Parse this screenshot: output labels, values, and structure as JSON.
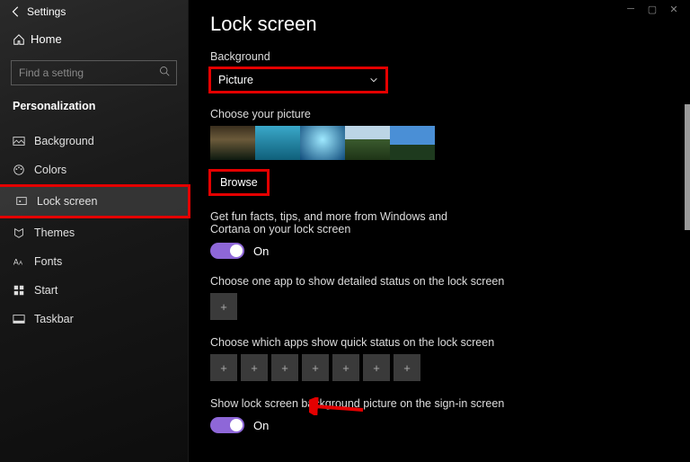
{
  "window": {
    "title": "Settings"
  },
  "sidebar": {
    "home": "Home",
    "search_placeholder": "Find a setting",
    "category": "Personalization",
    "items": [
      {
        "label": "Background"
      },
      {
        "label": "Colors"
      },
      {
        "label": "Lock screen"
      },
      {
        "label": "Themes"
      },
      {
        "label": "Fonts"
      },
      {
        "label": "Start"
      },
      {
        "label": "Taskbar"
      }
    ]
  },
  "page": {
    "title": "Lock screen",
    "background_label": "Background",
    "background_value": "Picture",
    "choose_picture_label": "Choose your picture",
    "browse": "Browse",
    "funfacts_label": "Get fun facts, tips, and more from Windows and Cortana on your lock screen",
    "funfacts_state": "On",
    "detailed_label": "Choose one app to show detailed status on the lock screen",
    "quick_label": "Choose which apps show quick status on the lock screen",
    "signin_label": "Show lock screen background picture on the sign-in screen",
    "signin_state": "On"
  }
}
